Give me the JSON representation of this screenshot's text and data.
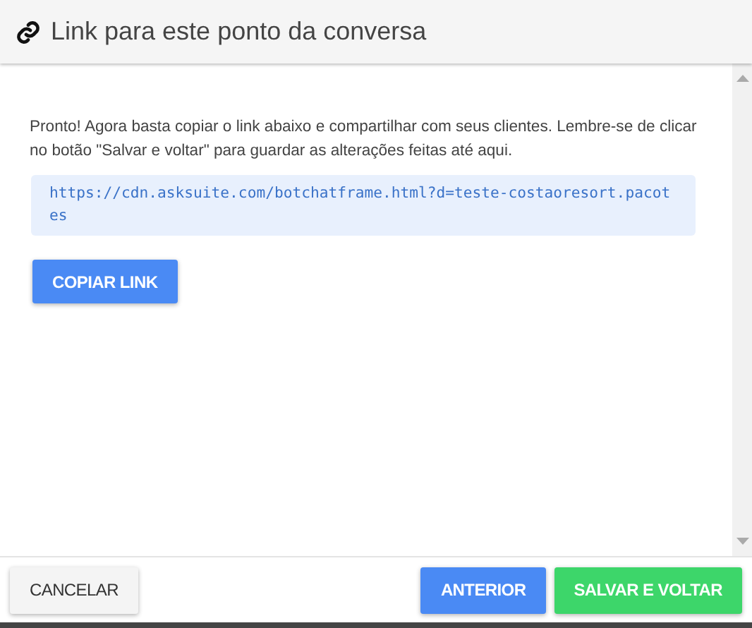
{
  "dialog": {
    "title": "Link para este ponto da conversa"
  },
  "body": {
    "message": "Pronto! Agora basta copiar o link abaixo e compartilhar com seus clientes. Lembre-se de clicar no botão \"Salvar e voltar\" para guardar as alterações feitas até aqui.",
    "link": "https://cdn.asksuite.com/botchatframe.html?d=teste-costaoresort.pacotes",
    "copy_button": "COPIAR LINK"
  },
  "footer": {
    "buttons": [
      {
        "label": "CANCELAR",
        "kind": "default"
      },
      {
        "label": "ANTERIOR",
        "kind": "primary"
      },
      {
        "label": "SALVAR E VOLTAR",
        "kind": "success"
      }
    ]
  }
}
